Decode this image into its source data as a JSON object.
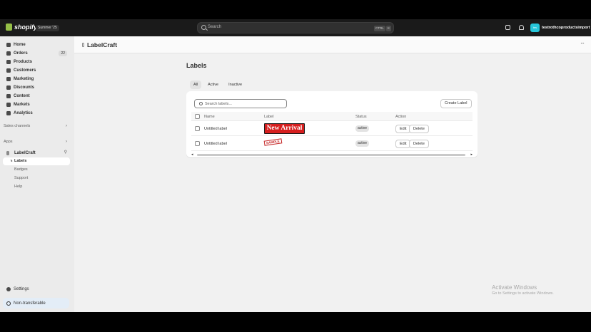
{
  "topbar": {
    "logo_text": "shopify",
    "edition": "Summer '25",
    "search_placeholder": "Search",
    "shortcut_ctrl": "CTRL",
    "shortcut_key": "K",
    "store_initials": "tes",
    "store_name": "testrothcoproductsimport"
  },
  "sidebar": {
    "items": [
      {
        "label": "Home"
      },
      {
        "label": "Orders",
        "count": "22"
      },
      {
        "label": "Products"
      },
      {
        "label": "Customers"
      },
      {
        "label": "Marketing"
      },
      {
        "label": "Discounts"
      },
      {
        "label": "Content"
      },
      {
        "label": "Markets"
      },
      {
        "label": "Analytics"
      }
    ],
    "sales_channels": "Sales channels",
    "apps": "Apps",
    "app_name": "LabelCraft",
    "app_sub": [
      "Labels",
      "Badges",
      "Support",
      "Help"
    ],
    "settings": "Settings",
    "non_transferable": "Non-transferable"
  },
  "app_header": {
    "title": "LabelCraft",
    "more": "···"
  },
  "page": {
    "title": "Labels",
    "tabs": [
      "All",
      "Active",
      "Inactive"
    ],
    "search_placeholder": "Search labels...",
    "create_button": "Create Label",
    "columns": {
      "name": "Name",
      "label": "Label",
      "status": "Status",
      "action": "Action"
    },
    "rows": [
      {
        "name": "Untitled label",
        "label_text": "New Arrival",
        "status": "active",
        "edit": "Edit",
        "delete": "Delete"
      },
      {
        "name": "Untitled label",
        "label_text": "SAMPLE",
        "status": "active",
        "edit": "Edit",
        "delete": "Delete"
      }
    ],
    "scroll_left": "◂",
    "scroll_right": "▸"
  },
  "watermark": {
    "line1": "Activate Windows",
    "line2": "Go to Settings to activate Windows."
  },
  "colors": {
    "shopify_green": "#95bf47",
    "arrival_red": "#d61e1e",
    "sample_red": "#c62828"
  }
}
